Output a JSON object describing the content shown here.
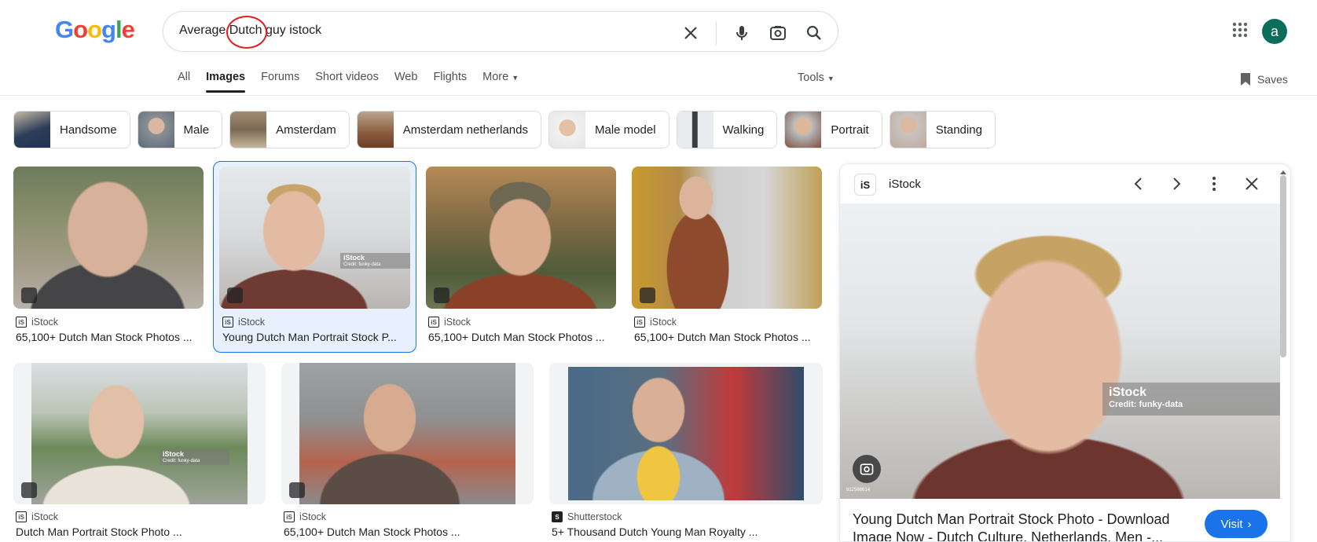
{
  "logo": {
    "letters": [
      "G",
      "o",
      "o",
      "g",
      "l",
      "e"
    ],
    "colors": [
      "#4285f4",
      "#ea4335",
      "#fbbc05",
      "#4285f4",
      "#34a853",
      "#ea4335"
    ]
  },
  "search": {
    "value": "Average Dutch guy istock"
  },
  "nav": {
    "items": [
      "All",
      "Images",
      "Forums",
      "Short videos",
      "Web",
      "Flights",
      "More"
    ],
    "active": "Images",
    "tools": "Tools",
    "saves": "Saves"
  },
  "account": {
    "initial": "a"
  },
  "chips": [
    "Handsome",
    "Male",
    "Amsterdam",
    "Amsterdam netherlands",
    "Male model",
    "Walking",
    "Portrait",
    "Standing"
  ],
  "results": [
    {
      "source": "iStock",
      "title": "65,100+ Dutch Man Stock Photos ..."
    },
    {
      "source": "iStock",
      "title": "Young Dutch Man Portrait Stock P..."
    },
    {
      "source": "iStock",
      "title": "65,100+ Dutch Man Stock Photos ..."
    },
    {
      "source": "iStock",
      "title": "65,100+ Dutch Man Stock Photos ..."
    },
    {
      "source": "iStock",
      "title": "Dutch Man Portrait Stock Photo ..."
    },
    {
      "source": "iStock",
      "title": "65,100+ Dutch Man Stock Photos ..."
    },
    {
      "source": "Shutterstock",
      "title": "5+ Thousand Dutch Young Man Royalty ..."
    }
  ],
  "watermarks": {
    "brand": "iStock",
    "credit": "Credit: funky-data",
    "id": "912568614"
  },
  "panel": {
    "source": "iStock",
    "title": "Young Dutch Man Portrait Stock Photo - Download Image Now - Dutch Culture, Netherlands, Men -...",
    "visit": "Visit"
  },
  "colors": {
    "accent": "#1a73e8",
    "annotation": "#e41e1e",
    "avatar": "#0b6e5b"
  }
}
